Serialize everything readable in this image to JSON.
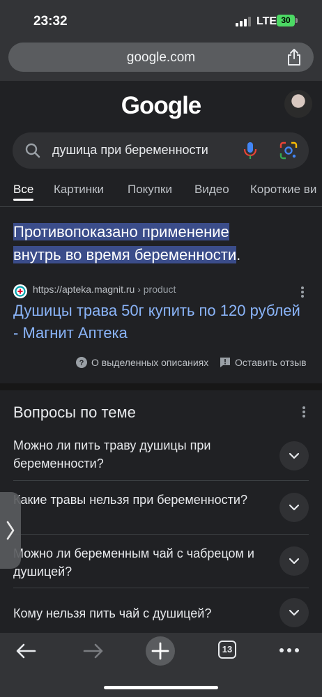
{
  "status": {
    "time": "23:32",
    "network": "LTE",
    "battery": "30"
  },
  "url_bar": {
    "url": "google.com",
    "share_icon": "share-icon"
  },
  "search": {
    "logo": "Google",
    "query": "душица при беременности"
  },
  "tabs": [
    "Все",
    "Картинки",
    "Покупки",
    "Видео",
    "Короткие ви"
  ],
  "featured": {
    "line1": "Противопоказано применение",
    "line2": "внутрь во время беременности",
    "line2_tail": ".",
    "source_url": "https://apteka.magnit.ru",
    "source_path": "› product",
    "title": "Душицы трава 50г купить по 120 рублей - Магнит Аптека",
    "about": "О выделенных описаниях",
    "feedback": "Оставить отзыв"
  },
  "paa": {
    "title": "Вопросы по теме",
    "questions": [
      "Можно ли пить траву душицы при беременности?",
      "Какие травы нельзя при беременности?",
      "Можно ли беременным чай с чабрецом и душицей?",
      "Кому нельзя пить чай с душицей?"
    ]
  },
  "toolbar": {
    "tab_count": "13"
  },
  "colors": {
    "background": "#202124",
    "link": "#8ab4f8",
    "highlight": "#3b4d8a",
    "chrome": "#333437"
  }
}
